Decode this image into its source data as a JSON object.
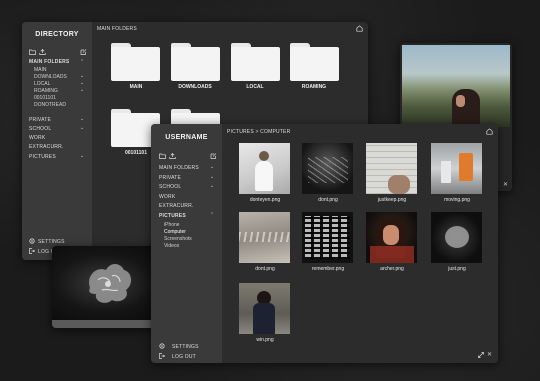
{
  "directory_window": {
    "title": "DIRECTORY",
    "breadcrumb": "MAIN FOLDERS",
    "nav": [
      {
        "label": "MAIN FOLDERS",
        "expanded": true
      },
      {
        "label": "MAIN"
      },
      {
        "label": "DOWNLOADS"
      },
      {
        "label": "LOCAL"
      },
      {
        "label": "ROAMING"
      },
      {
        "label": "00101101"
      },
      {
        "label": "DONOTREAD"
      },
      {
        "label": "PRIVATE"
      },
      {
        "label": "SCHOOL"
      },
      {
        "label": "WORK"
      },
      {
        "label": "EXTRACURR."
      },
      {
        "label": "PICTURES"
      }
    ],
    "settings_label": "SETTINGS",
    "logout_label": "LOG OUT",
    "folders": [
      "MAIN",
      "DOWNLOADS",
      "LOCAL",
      "ROAMING",
      "00101101",
      ""
    ]
  },
  "user_window": {
    "title": "USERNAME",
    "breadcrumb": "PICTURES > COMPUTER",
    "nav": [
      {
        "label": "MAIN FOLDERS"
      },
      {
        "label": "PRIVATE"
      },
      {
        "label": "SCHOOL"
      },
      {
        "label": "WORK"
      },
      {
        "label": "EXTRACURR."
      },
      {
        "label": "PICTURES",
        "expanded": true
      }
    ],
    "sub_items": [
      "iPhone",
      "Computer",
      "Screenshots",
      "Videos"
    ],
    "settings_label": "SETTINGS",
    "logout_label": "LOG OUT",
    "files": [
      "donteyen.png",
      "dont.png",
      "justkeep.png",
      "moving.png",
      "dont.png",
      "remember.png",
      "archer.png",
      "just.png",
      "win.png"
    ]
  },
  "colors": {
    "window_bg": "#2c2c2c",
    "sidebar_bg": "#3a3a3a",
    "folder": "#f4f4f4"
  }
}
